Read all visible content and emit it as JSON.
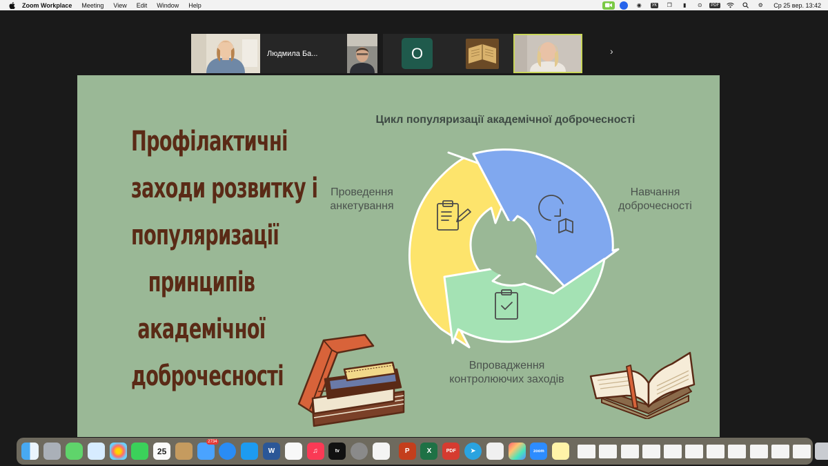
{
  "menubar": {
    "app_name": "Zoom Workplace",
    "items": [
      "Meeting",
      "View",
      "Edit",
      "Window",
      "Help"
    ],
    "tray": {
      "keyboard_layout": "УК",
      "clock": "Ср 25 вер.  13:42"
    }
  },
  "gallery": {
    "participant_name": "Людмила Ба...",
    "avatar_initial": "О",
    "next_arrow": "›"
  },
  "slide": {
    "title_lines": [
      "Профілактичні",
      "заходи розвитку і",
      "популяризації",
      "принципів",
      "академічної",
      "доброчесності"
    ],
    "cycle_title": "Цикл популяризації академічної доброчесності",
    "steps": {
      "survey": "Проведення анкетування",
      "training": "Навчання доброчесності",
      "control": "Впровадження контролюючих заходів"
    },
    "colors": {
      "background": "#9ab896",
      "title": "#5a2a16",
      "yellow": "#fde46c",
      "blue": "#80a8ef",
      "green": "#a4e2b4"
    }
  },
  "dock": {
    "calendar_day": "25",
    "mail_badge": "2734"
  }
}
